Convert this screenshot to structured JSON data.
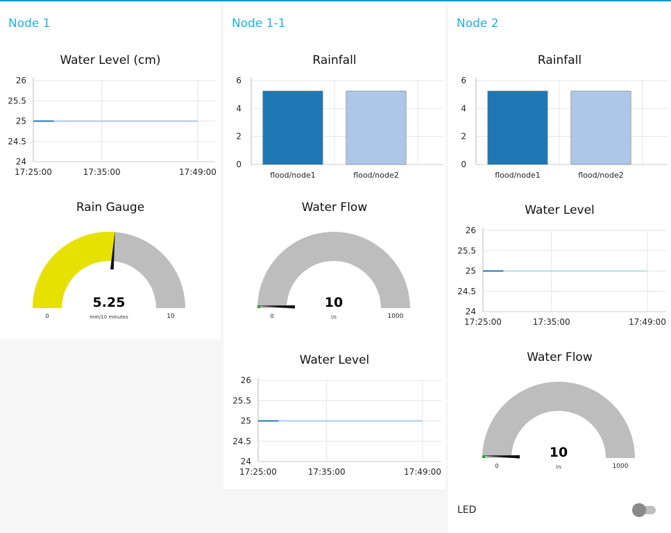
{
  "colors": {
    "accent": "#0094ce",
    "group_title": "#1bb2e6",
    "series_dark": "#1f77b4",
    "series_light": "#aec7e8",
    "gauge_yellow": "#e6e100",
    "gauge_grey": "#bdbdbd",
    "gauge_green": "#00b500"
  },
  "groups": [
    {
      "title": "Node 1"
    },
    {
      "title": "Node 1-1"
    },
    {
      "title": "Node 2"
    }
  ],
  "widgets": {
    "n1_level_chart": {
      "title": "Water Level (cm)"
    },
    "n1_rain_gauge": {
      "title": "Rain Gauge",
      "value": "5.25",
      "unit": "mm/10 minutes",
      "min": "0",
      "max": "10",
      "level": 0.525,
      "fill_color": "#e6e100"
    },
    "n11_rain_chart": {
      "title": "Rainfall"
    },
    "n11_flow_gauge": {
      "title": "Water Flow",
      "value": "10",
      "unit": "l/s",
      "min": "0",
      "max": "1000",
      "level": 0.01,
      "fill_color": "#00b500"
    },
    "n11_level_chart": {
      "title": "Water Level"
    },
    "n2_rain_chart": {
      "title": "Rainfall"
    },
    "n2_level_chart": {
      "title": "Water Level"
    },
    "n2_flow_gauge": {
      "title": "Water Flow",
      "value": "10",
      "unit": "l/s",
      "min": "0",
      "max": "1000",
      "level": 0.01,
      "fill_color": "#00b500"
    },
    "n2_led": {
      "label": "LED",
      "state": "off"
    }
  },
  "chart_data": [
    {
      "id": "n1_level_chart",
      "type": "line",
      "title": "Water Level (cm)",
      "ylim": [
        24,
        26
      ],
      "y_ticks": [
        "26",
        "25.5",
        "25",
        "24.5",
        "24"
      ],
      "x_ticks": [
        "17:25:00",
        "17:35:00",
        "17:49:00"
      ],
      "grid": true,
      "series": [
        {
          "color": "#1f77b4",
          "x": [
            "17:25:00",
            "17:28:00"
          ],
          "y": [
            25,
            25
          ]
        },
        {
          "color": "#aec7e8",
          "x": [
            "17:28:00",
            "17:49:00"
          ],
          "y": [
            25,
            25
          ]
        }
      ]
    },
    {
      "id": "n11_rain_chart",
      "type": "bar",
      "title": "Rainfall",
      "categories": [
        "flood/node1",
        "flood/node2"
      ],
      "values": [
        5.25,
        5.25
      ],
      "bar_colors": [
        "#1f77b4",
        "#aec7e8"
      ],
      "ylim": [
        0,
        6
      ],
      "y_ticks": [
        "6",
        "4",
        "2",
        "0"
      ],
      "grid": true
    },
    {
      "id": "n11_level_chart",
      "type": "line",
      "title": "Water Level",
      "ylim": [
        24,
        26
      ],
      "y_ticks": [
        "26",
        "25.5",
        "25",
        "24.5",
        "24"
      ],
      "x_ticks": [
        "17:25:00",
        "17:35:00",
        "17:49:00"
      ],
      "grid": true,
      "series": [
        {
          "color": "#1f77b4",
          "x": [
            "17:25:00",
            "17:28:00"
          ],
          "y": [
            25,
            25
          ]
        },
        {
          "color": "#aec7e8",
          "x": [
            "17:28:00",
            "17:49:00"
          ],
          "y": [
            25,
            25
          ]
        }
      ]
    },
    {
      "id": "n2_rain_chart",
      "type": "bar",
      "title": "Rainfall",
      "categories": [
        "flood/node1",
        "flood/node2"
      ],
      "values": [
        5.25,
        5.25
      ],
      "bar_colors": [
        "#1f77b4",
        "#aec7e8"
      ],
      "ylim": [
        0,
        6
      ],
      "y_ticks": [
        "6",
        "4",
        "2",
        "0"
      ],
      "grid": true
    },
    {
      "id": "n2_level_chart",
      "type": "line",
      "title": "Water Level",
      "ylim": [
        24,
        26
      ],
      "y_ticks": [
        "26",
        "25.5",
        "25",
        "24.5",
        "24"
      ],
      "x_ticks": [
        "17:25:00",
        "17:35:00",
        "17:49:00"
      ],
      "grid": true,
      "series": [
        {
          "color": "#1f77b4",
          "x": [
            "17:25:00",
            "17:28:00"
          ],
          "y": [
            25,
            25
          ]
        },
        {
          "color": "#b8d8e6",
          "x": [
            "17:28:00",
            "17:49:00"
          ],
          "y": [
            25,
            25
          ]
        }
      ]
    }
  ]
}
